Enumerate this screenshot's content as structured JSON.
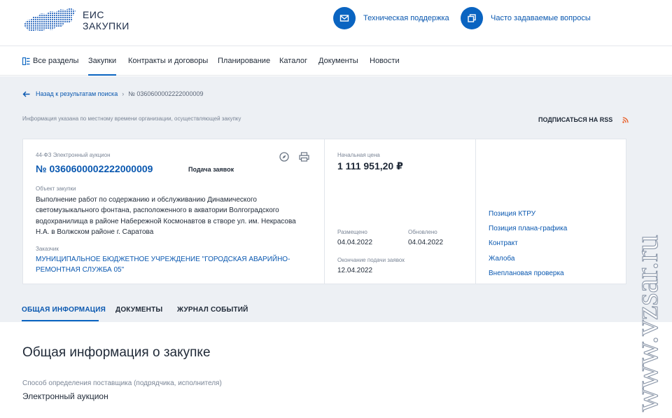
{
  "header": {
    "logo_line1": "ЕИС",
    "logo_line2": "ЗАКУПКИ",
    "support_label": "Техническая поддержка",
    "faq_label": "Часто задаваемые вопросы"
  },
  "nav": {
    "items": [
      "Все разделы",
      "Закупки",
      "Контракты и договоры",
      "Планирование",
      "Каталог",
      "Документы",
      "Новости"
    ],
    "active": "Закупки"
  },
  "breadcrumb": {
    "back": "Назад к результатам поиска",
    "separator": "›",
    "current": "№ 0360600002222000009"
  },
  "timezone_note": "Информация указана по местному времени организации, осуществляющей закупку",
  "rss_label": "ПОДПИСАТЬСЯ НА RSS",
  "card": {
    "procedure_type": "44-ФЗ Электронный аукцион",
    "number": "№ 0360600002222000009",
    "stage": "Подача заявок",
    "object_label": "Объект закупки",
    "object_text": "Выполнение работ по содержанию и обслуживанию Динамического светомузыкального фонтана, расположенного в акватории Волгоградского водохранилища в районе Набережной Космонавтов в створе ул. им. Некрасова Н.А. в Волжском районе г. Саратова",
    "customer_label": "Заказчик",
    "customer_text": "МУНИЦИПАЛЬНОЕ БЮДЖЕТНОЕ УЧРЕЖДЕНИЕ \"ГОРОДСКАЯ АВАРИЙНО-РЕМОНТНАЯ СЛУЖБА 05\"",
    "price_label": "Начальная цена",
    "price": "1 111 951,20 ₽",
    "published_label": "Размещено",
    "published": "04.04.2022",
    "updated_label": "Обновлено",
    "updated": "04.04.2022",
    "deadline_label": "Окончание подачи заявок",
    "deadline": "12.04.2022",
    "links": [
      "Позиция КТРУ",
      "Позиция плана-графика",
      "Контракт",
      "Жалоба",
      "Внеплановая проверка"
    ]
  },
  "tabs": [
    "ОБЩАЯ ИНФОРМАЦИЯ",
    "ДОКУМЕНТЫ",
    "ЖУРНАЛ СОБЫТИЙ"
  ],
  "content": {
    "section_title": "Общая информация о закупке",
    "method_label": "Способ определения поставщика (подрядчика, исполнителя)",
    "method_value": "Электронный аукцион"
  },
  "watermark": "www.vzsar.ru",
  "colors": {
    "accent": "#0a64c1",
    "link": "#0a58b0",
    "rss": "#e8581f",
    "grey_bg": "#edf0f4"
  }
}
